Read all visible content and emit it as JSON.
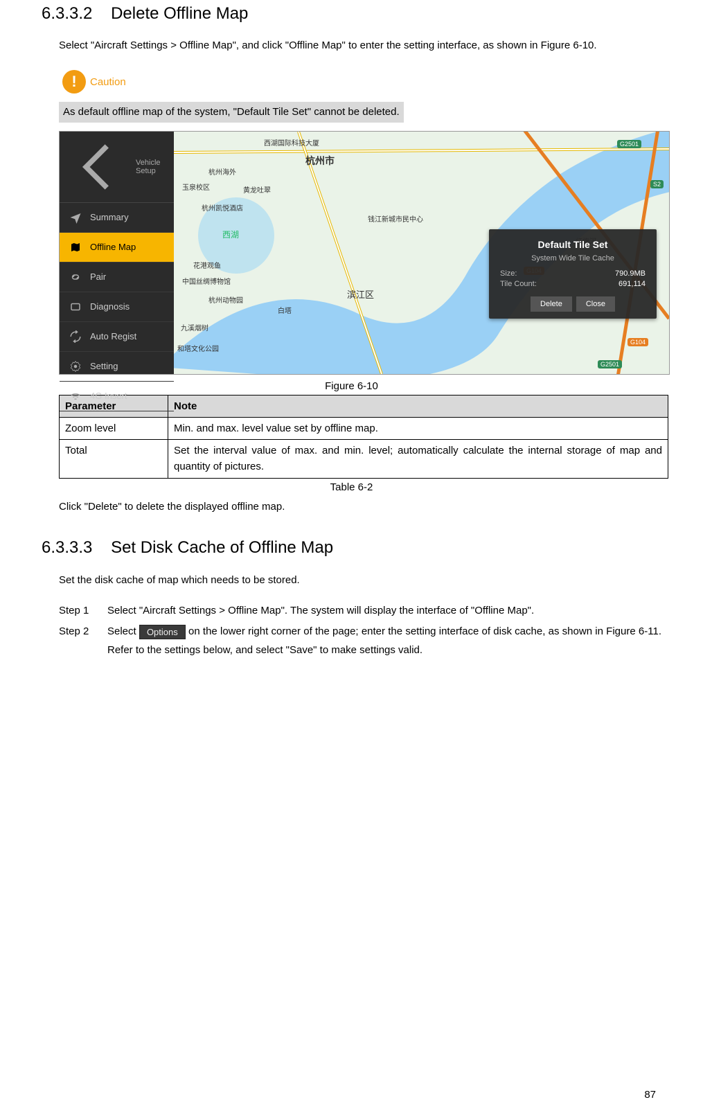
{
  "sec_a": {
    "num": "6.3.3.2",
    "title": "Delete Offline Map",
    "intro": "Select \"Aircraft Settings > Offline Map\", and click \"Offline Map\" to enter the setting interface, as shown in Figure 6-10.",
    "caution_label": "Caution",
    "caution_text": "As default offline map of the system, \"Default Tile Set\" cannot be deleted.",
    "fig_caption": "Figure 6-10",
    "after_fig": "Click \"Delete\" to delete the displayed offline map."
  },
  "sidebar": {
    "header": "Vehicle Setup",
    "items": [
      "Summary",
      "Offline Map",
      "Pair",
      "Diagnosis",
      "Auto Regist",
      "Setting",
      "4G Insert"
    ]
  },
  "map_labels": {
    "a": "西湖国际科技大厦",
    "b": "杭州市",
    "c": "杭州海外",
    "d": "玉泉校区",
    "e": "黄龙吐翠",
    "f": "杭州凯悦酒店",
    "g": "钱江新城市民中心",
    "h": "花港观鱼",
    "i": "中国丝绸博物馆",
    "j": "杭州动物园",
    "k": "九溪烟树",
    "l": "和塔文化公园",
    "m": "滨江区",
    "n": "白塔",
    "o": "红旗河",
    "circle": "西湖"
  },
  "badges": {
    "g1": "G2501",
    "g2": "G2501",
    "s1": "S2",
    "r1": "G104",
    "r2": "G104"
  },
  "popup": {
    "title": "Default Tile Set",
    "sub": "System Wide Tile Cache",
    "size_k": "Size:",
    "size_v": "790.9MB",
    "count_k": "Tile Count:",
    "count_v": "691,114",
    "btn_del": "Delete",
    "btn_close": "Close"
  },
  "table": {
    "h1": "Parameter",
    "h2": "Note",
    "r1c1": "Zoom level",
    "r1c2": "Min. and max. level value set by offline map.",
    "r2c1": "Total",
    "r2c2": "Set the interval value of max. and min. level; automatically calculate the internal storage of map and quantity of pictures.",
    "caption": "Table 6-2"
  },
  "sec_b": {
    "num": "6.3.3.3",
    "title": "Set Disk Cache of Offline Map",
    "intro": "Set the disk cache of map which needs to be stored.",
    "step1_lbl": "Step 1",
    "step1": "Select \"Aircraft Settings > Offline Map\". The system will display the interface of \"Offline Map\".",
    "step2_lbl": "Step 2",
    "step2_a": "Select ",
    "opt_btn": "Options",
    "step2_b": " on the lower right corner of the page; enter the setting interface of disk cache, as shown in Figure 6-11. Refer to the settings below, and select \"Save\" to make settings valid."
  },
  "page_number": "87"
}
